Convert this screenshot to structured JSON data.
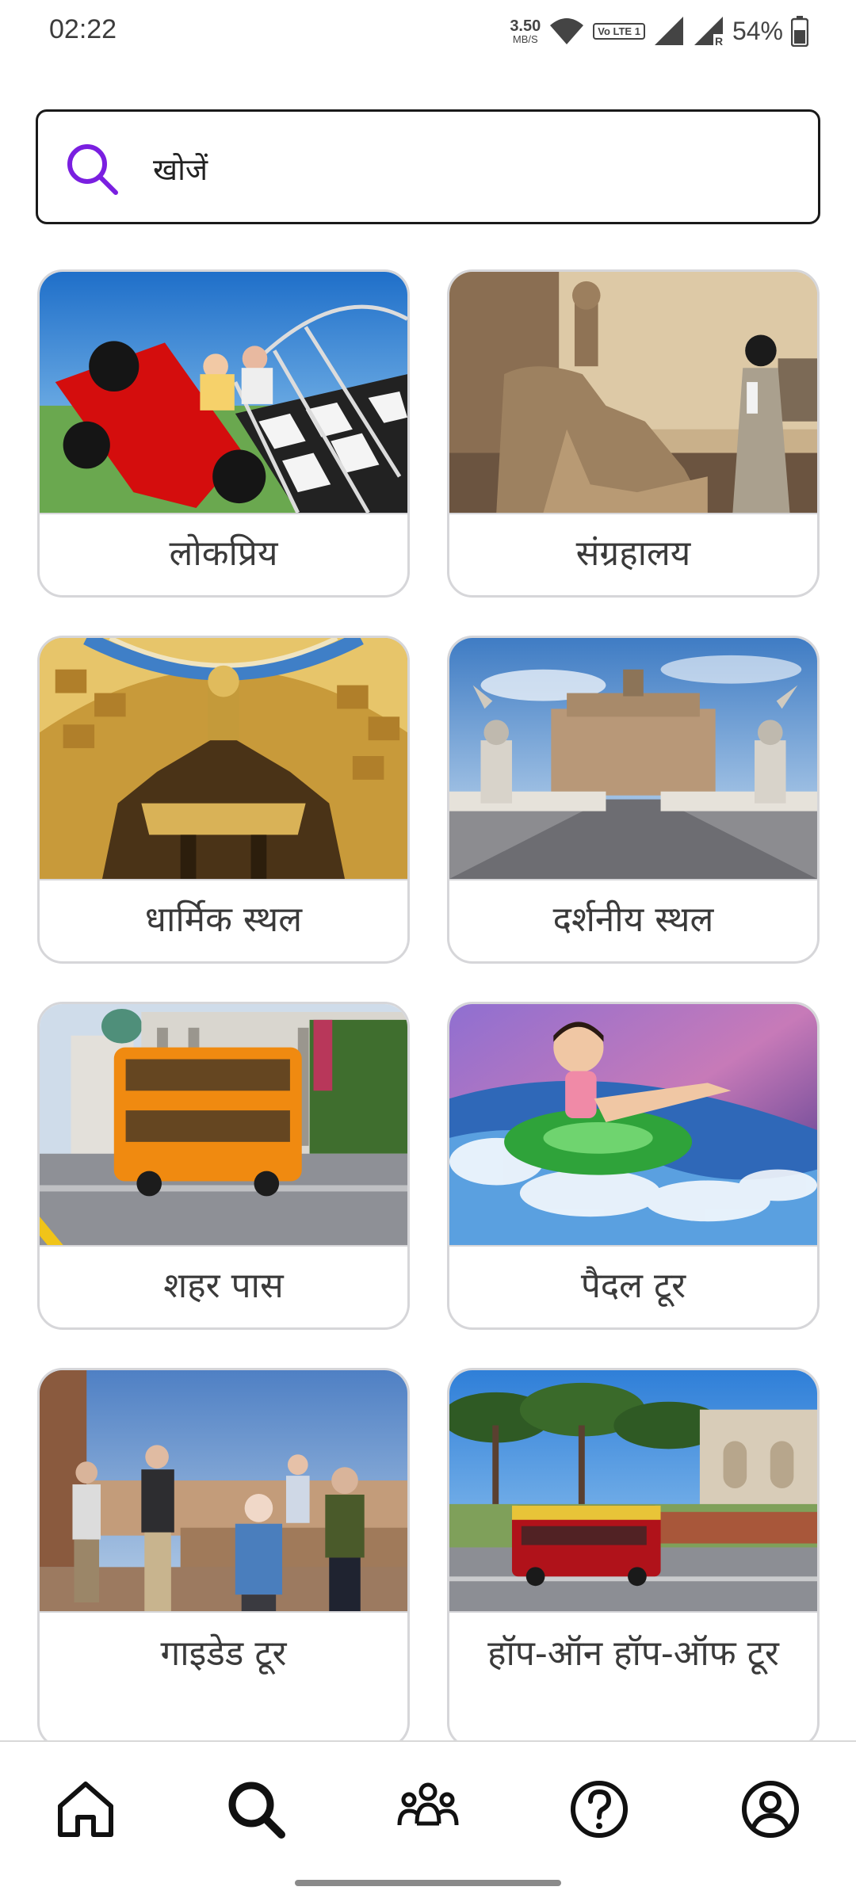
{
  "status_bar": {
    "time": "02:22",
    "net_speed_value": "3.50",
    "net_speed_unit": "MB/S",
    "volte_label": "Vo LTE 1",
    "battery": "54%"
  },
  "search": {
    "label": "खोजें",
    "icon": "search-icon",
    "icon_color": "#7a1fe0"
  },
  "categories": [
    {
      "label": "लोकप्रिय",
      "image": "race-car-ride-photo"
    },
    {
      "label": "संग्रहालय",
      "image": "museum-statue-photo"
    },
    {
      "label": "धार्मिक स्थल",
      "image": "basilica-dome-photo"
    },
    {
      "label": "दर्शनीय स्थल",
      "image": "castle-bridge-photo"
    },
    {
      "label": "शहर पास",
      "image": "double-decker-bus-photo"
    },
    {
      "label": "पैदल टूर",
      "image": "water-slide-photo"
    },
    {
      "label": "गाइडेड टूर",
      "image": "tour-group-photo"
    },
    {
      "label": "हॉप-ऑन हॉप-ऑफ टूर",
      "image": "hop-on-bus-photo"
    }
  ],
  "bottom_nav": [
    {
      "name": "home",
      "icon": "home-icon"
    },
    {
      "name": "search",
      "icon": "search-icon",
      "active": true
    },
    {
      "name": "community",
      "icon": "people-icon"
    },
    {
      "name": "help",
      "icon": "help-icon"
    },
    {
      "name": "profile",
      "icon": "profile-icon"
    }
  ]
}
